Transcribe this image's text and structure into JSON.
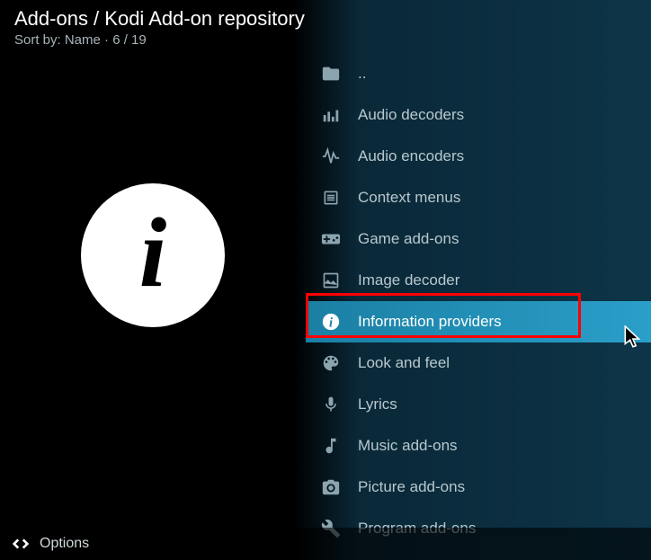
{
  "header": {
    "breadcrumb": "Add-ons / Kodi Add-on repository",
    "sort_label": "Sort by: Name  ·  6 / 19"
  },
  "items": [
    {
      "label": ".."
    },
    {
      "label": "Audio decoders"
    },
    {
      "label": "Audio encoders"
    },
    {
      "label": "Context menus"
    },
    {
      "label": "Game add-ons"
    },
    {
      "label": "Image decoder"
    },
    {
      "label": "Information providers"
    },
    {
      "label": "Look and feel"
    },
    {
      "label": "Lyrics"
    },
    {
      "label": "Music add-ons"
    },
    {
      "label": "Picture add-ons"
    },
    {
      "label": "Program add-ons"
    }
  ],
  "footer": {
    "options_label": "Options"
  }
}
